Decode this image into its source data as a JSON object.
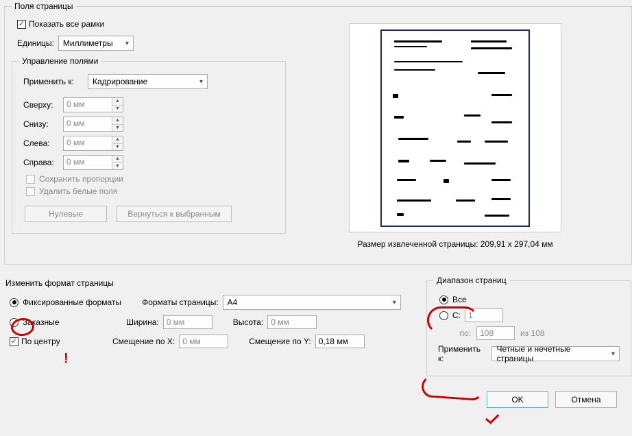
{
  "page_margins": {
    "title": "Поля страницы",
    "show_all_frames": "Показать все рамки",
    "units_label": "Единицы:",
    "units_value": "Миллиметры",
    "manage_margins": {
      "title": "Управление полями",
      "apply_to_label": "Применить к:",
      "apply_to_value": "Кадрирование",
      "top_label": "Сверху:",
      "top_value": "0 мм",
      "bottom_label": "Снизу:",
      "bottom_value": "0 мм",
      "left_label": "Слева:",
      "left_value": "0 мм",
      "right_label": "Справа:",
      "right_value": "0 мм",
      "keep_proportions": "Сохранить пропорции",
      "remove_white_margins": "Удалить белые поля",
      "zero_btn": "Нулевые",
      "revert_btn": "Вернуться к выбранным"
    }
  },
  "preview_label": "Размер извлеченной страницы: 209,91 x 297,04 мм",
  "resize": {
    "title": "Изменить формат страницы",
    "fixed_formats": "Фиксированные форматы",
    "custom": "Заказные",
    "page_formats_label": "Форматы страницы:",
    "page_formats_value": "A4",
    "width_label": "Ширина:",
    "width_value": "0 мм",
    "height_label": "Высота:",
    "height_value": "0 мм",
    "center": "По центру",
    "offset_x_label": "Смещение по X:",
    "offset_x_value": "0 мм",
    "offset_y_label": "Смещение по Y:",
    "offset_y_value": "0,18 мм"
  },
  "page_range": {
    "title": "Диапазон страниц",
    "all": "Все",
    "from_lbl": "С:",
    "from_value": "1",
    "to_lbl": "по:",
    "to_value": "108",
    "of_label": "из 108",
    "apply_to_label": "Применить к:",
    "apply_to_value": "Четные и нечетные страницы"
  },
  "footer": {
    "ok": "OK",
    "cancel": "Отмена"
  }
}
